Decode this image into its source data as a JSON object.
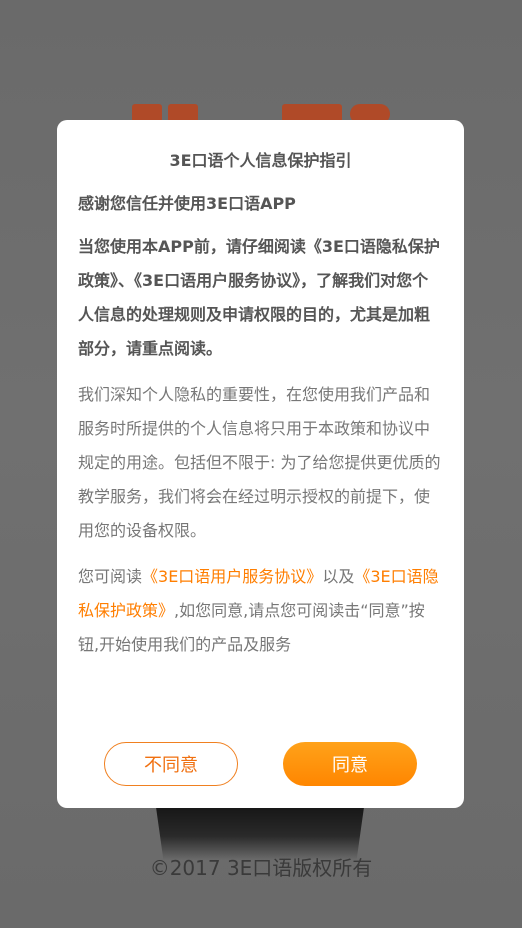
{
  "background": {
    "copyright": "©2017 3E口语版权所有"
  },
  "dialog": {
    "title": "3E口语个人信息保护指引",
    "thanks": "感谢您信任并使用3E口语APP",
    "bold_paragraph": "当您使用本APP前，请仔细阅读《3E口语隐私保护政策》、《3E口语用户服务协议》，了解我们对您个人信息的处理规则及申请权限的目的，尤其是加粗部分，请重点阅读。",
    "paragraph": "我们深知个人隐私的重要性，在您使用我们产品和服务时所提供的个人信息将只用于本政策和协议中规定的用途。包括但不限于: 为了给您提供更优质的教学服务，我们将会在经过明示授权的前提下，使用您的设备权限。",
    "links_paragraph": {
      "prefix": "您可阅读",
      "service_agreement_link": "《3E口语用户服务协议》",
      "and": "以及",
      "privacy_policy_link": "《3E口语隐私保护政策》",
      "suffix": ",如您同意,请点您可阅读击“同意”按钮,开始使用我们的产品及服务"
    },
    "disagree_label": "不同意",
    "agree_label": "同意"
  },
  "colors": {
    "accent": "#ff8600",
    "overlay": "#6b6b6b",
    "text_bold": "#555555",
    "text_normal": "#777777"
  }
}
